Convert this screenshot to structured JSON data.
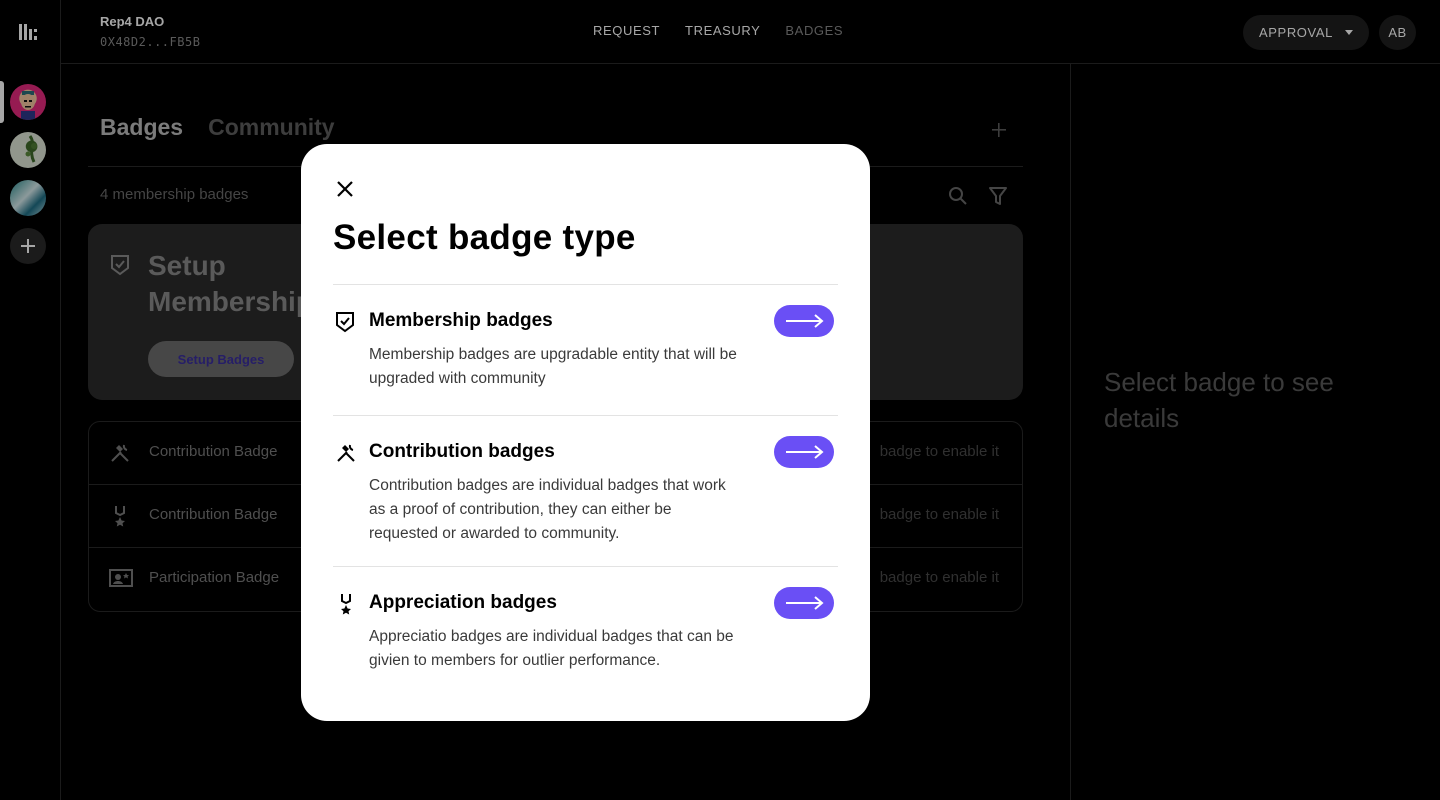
{
  "header": {
    "dao_name": "Rep4 DAO",
    "dao_address": "0X48D2...FB5B",
    "nav": [
      "REQUEST",
      "TREASURY",
      "BADGES"
    ],
    "approval_label": "APPROVAL",
    "user_initials": "AB"
  },
  "main": {
    "tabs": [
      "Badges",
      "Community"
    ],
    "badge_count": "4 membership badges",
    "setup_card": {
      "title": "Setup Membership",
      "button": "Setup Badges"
    },
    "badge_rows": [
      {
        "label": "Contribution Badge",
        "hint": "badge to enable it",
        "icon": "tools-icon"
      },
      {
        "label": "Contribution Badge",
        "hint": "badge to enable it",
        "icon": "medal-icon"
      },
      {
        "label": "Participation Badge",
        "hint": "badge to enable it",
        "icon": "id-card-icon"
      }
    ]
  },
  "detail": {
    "empty_text": "Select badge to see details"
  },
  "modal": {
    "title": "Select badge type",
    "options": [
      {
        "title": "Membership badges",
        "description": "Membership badges are upgradable entity that will be upgraded with community",
        "icon": "shield-check-icon"
      },
      {
        "title": "Contribution badges",
        "description": "Contribution badges are individual badges that work as a proof of contribution, they can either be requested or awarded to community.",
        "icon": "tools-icon"
      },
      {
        "title": "Appreciation badges",
        "description": "Appreciatio badges are individual badges that can be givien to members for outlier performance.",
        "icon": "medal-icon"
      }
    ]
  },
  "colors": {
    "accent": "#6a4ff5",
    "background": "#000000",
    "card": "#2b2b2b"
  }
}
